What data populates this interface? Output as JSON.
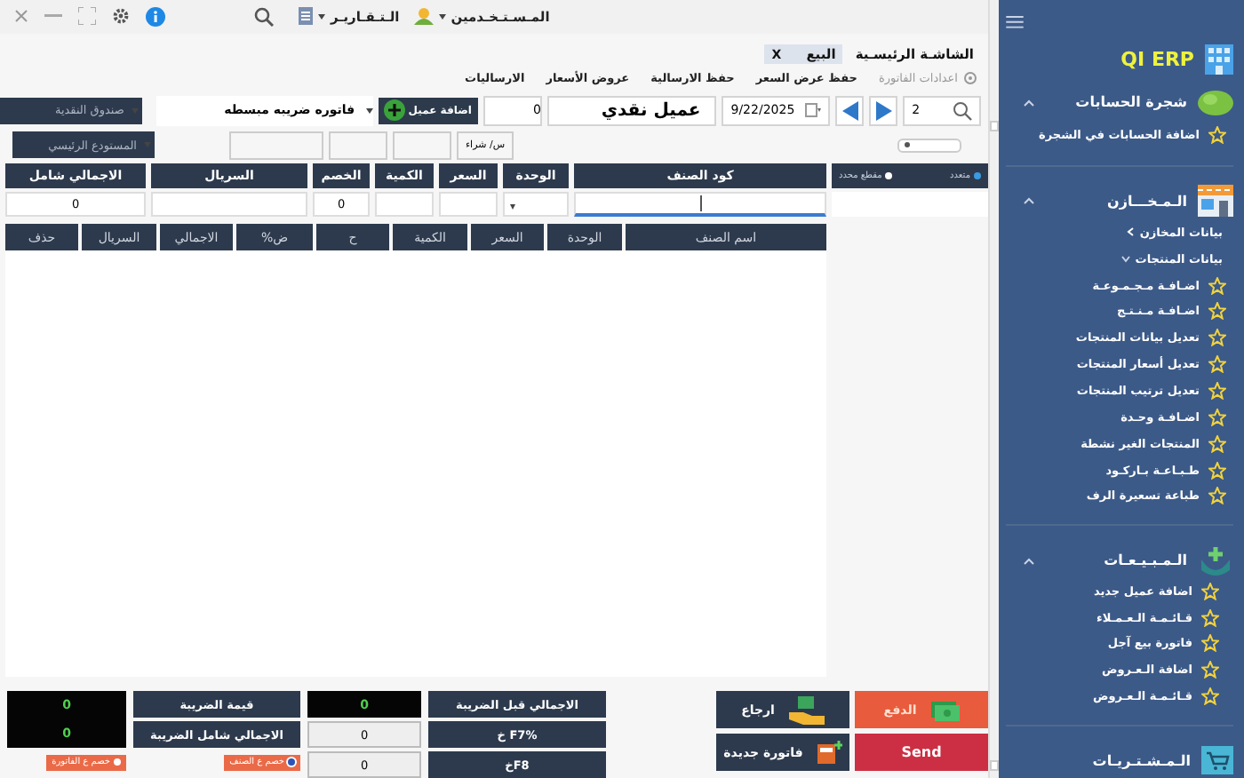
{
  "top_bar": {
    "menus": [
      {
        "label": "المـسـتـخـدمين"
      },
      {
        "label": "الـتـقـاريـر"
      }
    ]
  },
  "tabs": [
    {
      "label": "الشاشـة الرئيسـية",
      "selected": false
    },
    {
      "label": "البيع",
      "selected": true,
      "close": "X"
    }
  ],
  "toolbar": [
    {
      "label": "اعدادات الفاتورة",
      "disabled": true
    },
    {
      "label": "حفظ عرض السعر",
      "disabled": false
    },
    {
      "label": "حفظ الارسالية",
      "disabled": false
    },
    {
      "label": "عروض الأسعار",
      "disabled": false
    },
    {
      "label": "الارساليات",
      "disabled": false
    }
  ],
  "invoice": {
    "number": "2",
    "date": "9/22/2025",
    "customer": "عميل نقدي",
    "balance": "0",
    "add_customer": "اضافة عميل",
    "invoice_type": "فاتوره ضريبه مبسطه",
    "cash_box": "صندوق النقدية",
    "warehouse": "المستودع الرئيسي",
    "purchase_price": "س/ شراء"
  },
  "entry_mode": [
    {
      "label": "متعدد",
      "selected": true
    },
    {
      "label": "مقطع محدد",
      "selected": false
    }
  ],
  "entry_columns": [
    {
      "label": "كود الصنف"
    },
    {
      "label": "الوحدة"
    },
    {
      "label": "السعر"
    },
    {
      "label": "الكمية"
    },
    {
      "label": "الخصم",
      "value": "0"
    },
    {
      "label": "السريال"
    },
    {
      "label": "الاجمالي شامل",
      "value": "0"
    }
  ],
  "table": {
    "columns": [
      "اسم الصنف",
      "الوحدة",
      "السعر",
      "الكمية",
      "ح",
      "ض%",
      "الاجمالي",
      "السريال",
      "حذف"
    ]
  },
  "actions": [
    {
      "label": "الدفع",
      "kind": "pay"
    },
    {
      "label": "ارجاع",
      "kind": "return"
    },
    {
      "label": "Send",
      "kind": "send"
    },
    {
      "label": "فاتورة جديدة",
      "kind": "new"
    }
  ],
  "totals": {
    "before_tax": {
      "label": "الاجمالي قبل الضريبة",
      "value": "0"
    },
    "f7": {
      "label": "%F7 خ",
      "value": "0"
    },
    "f8": {
      "label": "F8خ",
      "value": "0"
    },
    "tax": {
      "label": "قيمة الضريبة",
      "value": "0"
    },
    "with_tax": {
      "label": "الاجمالي شامل الضريبة",
      "value": "0"
    }
  },
  "discount_mode": [
    {
      "label": "خصم ع الصنف",
      "selected": true
    },
    {
      "label": "خصم ع الفاتورة",
      "selected": false
    }
  ],
  "sidebar": {
    "brand": "QI ERP",
    "sections": [
      {
        "title": "شجرة الحسابات",
        "expanded": true,
        "items": [
          {
            "label": "اضافة الحسابات في الشجرة",
            "kind": "link"
          }
        ]
      },
      {
        "title": "الـمـخـــازن",
        "expanded": true,
        "items": [
          {
            "label": "بيانات المخازن",
            "kind": "group",
            "expanded": false
          },
          {
            "label": "بيانات المنتجات",
            "kind": "group",
            "expanded": true
          },
          {
            "label": "اضـافـة مـجـمـوعـة",
            "kind": "link"
          },
          {
            "label": "اضـافـة مـنـتـج",
            "kind": "link"
          },
          {
            "label": "تعديل بيانات المنتجات",
            "kind": "link"
          },
          {
            "label": "تعديل أسعار المنتجات",
            "kind": "link"
          },
          {
            "label": "تعديل ترتيب المنتجات",
            "kind": "link"
          },
          {
            "label": "اضـافـة وحـدة",
            "kind": "link"
          },
          {
            "label": "المنتجات الغير نشطة",
            "kind": "link"
          },
          {
            "label": "طـبـاعـة بـاركـود",
            "kind": "link"
          },
          {
            "label": "طباعة تسعيرة الرف",
            "kind": "link"
          }
        ]
      },
      {
        "title": "الـمـبـيـعـات",
        "expanded": true,
        "items": [
          {
            "label": "اضافة عميل جديد",
            "kind": "link"
          },
          {
            "label": "قـائـمـة الـعـمـلاء",
            "kind": "link"
          },
          {
            "label": "فاتورة بيع آجل",
            "kind": "link"
          },
          {
            "label": "اضافة الـعـروض",
            "kind": "link"
          },
          {
            "label": "قـائـمـة الـعـروض",
            "kind": "link"
          }
        ]
      },
      {
        "title": "الـمـشـتـريـات",
        "expanded": false
      }
    ]
  }
}
